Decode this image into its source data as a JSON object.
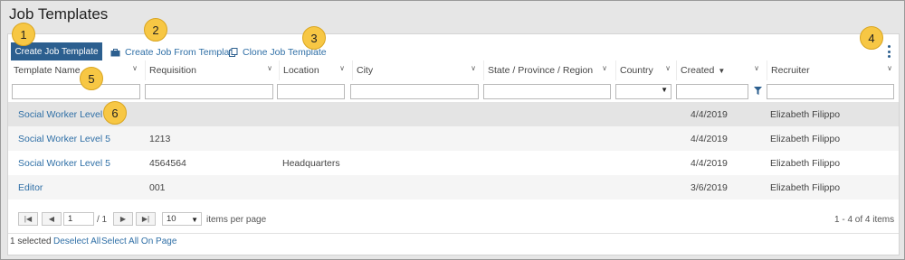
{
  "page": {
    "title": "Job Templates"
  },
  "toolbar": {
    "create_label": "Create Job Template",
    "from_template_label": "Create Job From Template",
    "clone_label": "Clone Job Template"
  },
  "badges": [
    "1",
    "2",
    "3",
    "4",
    "5",
    "6"
  ],
  "columns": [
    "Template Name",
    "Requisition",
    "Location",
    "City",
    "State / Province / Region",
    "Country",
    "Created",
    "Recruiter"
  ],
  "rows": [
    {
      "name": "Social Worker Level 2",
      "requisition": "",
      "location": "",
      "city": "",
      "state": "",
      "country": "",
      "created": "4/4/2019",
      "recruiter": "Elizabeth Filippo"
    },
    {
      "name": "Social Worker Level 5",
      "requisition": "1213",
      "location": "",
      "city": "",
      "state": "",
      "country": "",
      "created": "4/4/2019",
      "recruiter": "Elizabeth Filippo"
    },
    {
      "name": "Social Worker Level 5",
      "requisition": "4564564",
      "location": "Headquarters",
      "city": "",
      "state": "",
      "country": "",
      "created": "4/4/2019",
      "recruiter": "Elizabeth Filippo"
    },
    {
      "name": "Editor",
      "requisition": "001",
      "location": "",
      "city": "",
      "state": "",
      "country": "",
      "created": "3/6/2019",
      "recruiter": "Elizabeth Filippo"
    }
  ],
  "pager": {
    "page": "1",
    "total_pages": "/ 1",
    "page_size": "10",
    "per_page_label": "items per page",
    "summary": "1 - 4 of 4 items"
  },
  "footer": {
    "selected": "1 selected",
    "deselect_all": "Deselect All",
    "select_all_on_page": "Select All On Page"
  },
  "colors": {
    "accent": "#2c5f8f",
    "link": "#2f6fa6",
    "badge": "#f7c744"
  },
  "icons": [
    "briefcase-icon",
    "clone-icon",
    "kebab-menu-icon",
    "chevron-down-icon",
    "sort-desc-icon",
    "filter-funnel-icon",
    "first-page-icon",
    "prev-page-icon",
    "next-page-icon",
    "last-page-icon"
  ]
}
